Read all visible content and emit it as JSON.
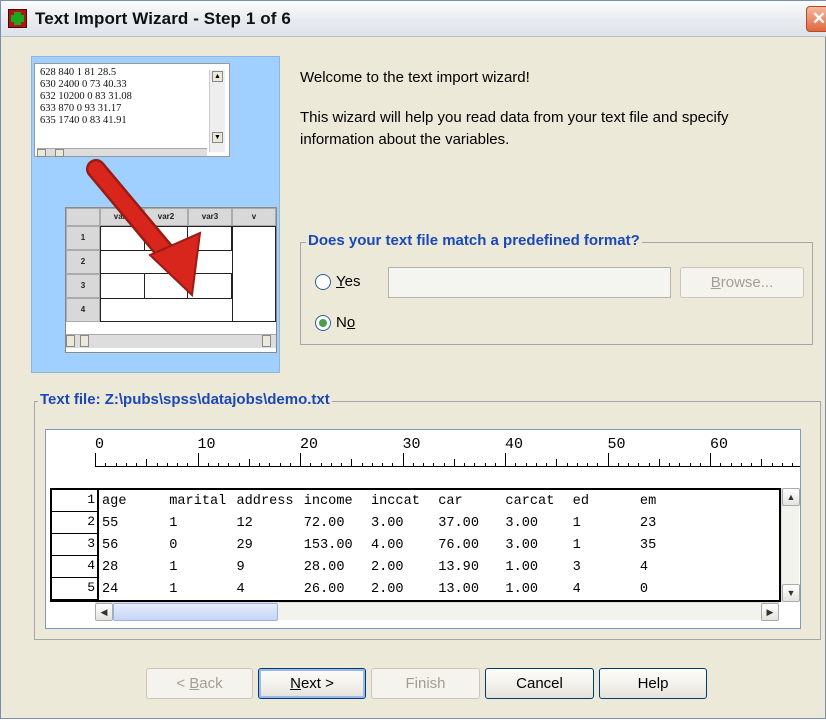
{
  "window": {
    "title": "Text Import Wizard - Step 1 of 6",
    "close_glyph": "✕"
  },
  "illustration": {
    "text_lines": [
      "628 840 1 81 28.5",
      "630 2400 0 73 40.33",
      "632 10200 0 83 31.08",
      "633 870 0 93 31.17",
      "635 1740 0 83 41.91"
    ],
    "grid_headers": [
      "var1",
      "var2",
      "var3",
      "v"
    ],
    "grid_rows": [
      "1",
      "2",
      "3",
      "4"
    ]
  },
  "intro": {
    "welcome": "Welcome to the text import wizard!",
    "description": "This wizard will help you read data from your text file and specify information about the variables."
  },
  "format_group": {
    "title": "Does your text file match a predefined format?",
    "yes_label_prefix": "",
    "yes_mnemonic": "Y",
    "yes_label_rest": "es",
    "no_label_prefix": "N",
    "no_mnemonic": "o",
    "no_label_rest": "",
    "selected": "No",
    "path_value": "",
    "browse_mnemonic": "B",
    "browse_rest": "rowse..."
  },
  "text_file": {
    "label": "Text file:  Z:\\pubs\\spss\\datajobs\\demo.txt",
    "ruler_numbers": [
      "0",
      "10",
      "20",
      "30",
      "40",
      "50",
      "60"
    ],
    "columns": [
      "age",
      "marital",
      "address",
      "income",
      "inccat",
      "car",
      "carcat",
      "ed",
      "em"
    ],
    "rows": [
      {
        "num": "1",
        "cells": [
          "age",
          "marital",
          "address",
          "income",
          "inccat",
          "car",
          "carcat",
          "ed",
          "em"
        ]
      },
      {
        "num": "2",
        "cells": [
          "55",
          "1",
          "12",
          "72.00",
          "3.00",
          "37.00",
          "3.00",
          "1",
          "23"
        ]
      },
      {
        "num": "3",
        "cells": [
          "56",
          "0",
          "29",
          "153.00",
          "4.00",
          "76.00",
          "3.00",
          "1",
          "35"
        ]
      },
      {
        "num": "4",
        "cells": [
          "28",
          "1",
          "9",
          "28.00",
          "2.00",
          "13.90",
          "1.00",
          "3",
          "4"
        ]
      },
      {
        "num": "5",
        "cells": [
          "24",
          "1",
          "4",
          "26.00",
          "2.00",
          "13.00",
          "1.00",
          "4",
          "0"
        ]
      }
    ]
  },
  "buttons": {
    "back_prefix": "< ",
    "back_mnemonic": "B",
    "back_rest": "ack",
    "next_mnemonic": "N",
    "next_rest": "ext >",
    "finish": "Finish",
    "cancel": "Cancel",
    "help": "Help"
  },
  "colors": {
    "group_title": "#1a48b8",
    "window_bg": "#ece9d8",
    "illustration_bg": "#9fd0ff",
    "arrow": "#d9261c"
  }
}
